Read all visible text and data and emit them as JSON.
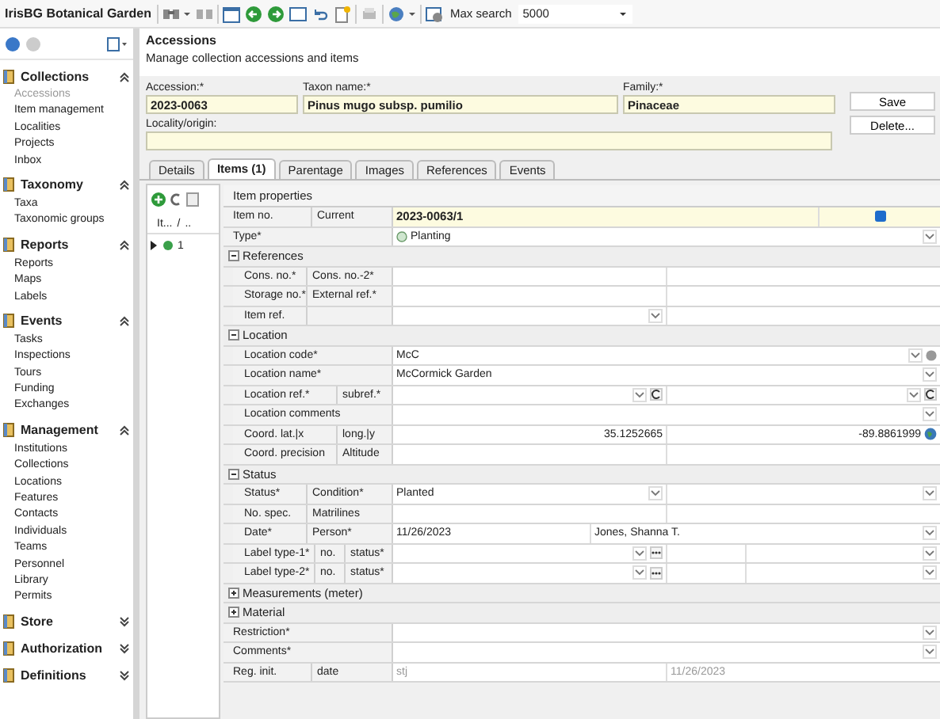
{
  "app": {
    "title": "IrisBG Botanical Garden",
    "max_search_label": "Max search",
    "max_search": "5000"
  },
  "sidebar": {
    "groups": [
      {
        "title": "Collections",
        "expanded": true,
        "items": [
          {
            "label": "Accessions",
            "selected": true
          },
          {
            "label": "Item management",
            "selected": false
          },
          {
            "label": "Localities",
            "selected": false
          },
          {
            "label": "Projects",
            "selected": false
          },
          {
            "label": "Inbox",
            "selected": false
          }
        ]
      },
      {
        "title": "Taxonomy",
        "expanded": true,
        "items": [
          {
            "label": "Taxa",
            "selected": false
          },
          {
            "label": "Taxonomic groups",
            "selected": false
          }
        ]
      },
      {
        "title": "Reports",
        "expanded": true,
        "items": [
          {
            "label": "Reports",
            "selected": false
          },
          {
            "label": "Maps",
            "selected": false
          },
          {
            "label": "Labels",
            "selected": false
          }
        ]
      },
      {
        "title": "Events",
        "expanded": true,
        "items": [
          {
            "label": "Tasks",
            "selected": false
          },
          {
            "label": "Inspections",
            "selected": false
          },
          {
            "label": "Tours",
            "selected": false
          },
          {
            "label": "Funding",
            "selected": false
          },
          {
            "label": "Exchanges",
            "selected": false
          }
        ]
      },
      {
        "title": "Management",
        "expanded": true,
        "items": [
          {
            "label": "Institutions",
            "selected": false
          },
          {
            "label": "Collections",
            "selected": false
          },
          {
            "label": "Locations",
            "selected": false
          },
          {
            "label": "Features",
            "selected": false
          },
          {
            "label": "Contacts",
            "selected": false
          },
          {
            "label": "Individuals",
            "selected": false
          },
          {
            "label": "Teams",
            "selected": false
          },
          {
            "label": "Personnel",
            "selected": false
          },
          {
            "label": "Library",
            "selected": false
          },
          {
            "label": "Permits",
            "selected": false
          }
        ]
      },
      {
        "title": "Store",
        "expanded": false
      },
      {
        "title": "Authorization",
        "expanded": false
      },
      {
        "title": "Definitions",
        "expanded": false
      }
    ]
  },
  "header": {
    "title": "Accessions",
    "subtitle": "Manage collection accessions and items"
  },
  "fields": [
    {
      "label": "Accession:*",
      "value": "2023-0063"
    },
    {
      "label": "Taxon name:*",
      "value": "Pinus mugo subsp. pumilio"
    },
    {
      "label": "Family:*",
      "value": "Pinaceae"
    },
    {
      "label": "Locality/origin:"
    }
  ],
  "buttons": [
    "Save",
    "Delete..."
  ],
  "tabs": [
    {
      "label": "Details",
      "selected": false
    },
    {
      "label": "Items (1)",
      "selected": true
    },
    {
      "label": "Parentage",
      "selected": false
    },
    {
      "label": "Images",
      "selected": false
    },
    {
      "label": "References",
      "selected": false
    },
    {
      "label": "Events",
      "selected": false
    }
  ],
  "item_list": {
    "columns": [
      "It...",
      "/",
      ".."
    ],
    "rows": [
      {
        "text": "1",
        "current": true
      }
    ]
  },
  "properties": {
    "title": "Item properties",
    "rows": [
      {
        "kind": "pair",
        "highlight": true,
        "labels": [
          "Item no.",
          "Current"
        ],
        "cells": [
          {
            "kind": "key",
            "text": "2023-0063/1"
          },
          {
            "kind": "check",
            "checked": true
          }
        ]
      },
      {
        "kind": "single",
        "labels": [
          "Type*"
        ],
        "cells": [
          {
            "kind": "icon-dropdown",
            "text": "Planting"
          }
        ]
      },
      {
        "kind": "section",
        "title": "References",
        "expanded": true,
        "children": [
          {
            "kind": "pair",
            "labels": [
              "Cons. no.*",
              "Cons. no.-2*"
            ],
            "cells": [
              {
                "kind": "text"
              },
              {
                "kind": "text"
              }
            ]
          },
          {
            "kind": "pair",
            "labels": [
              "Storage no.*",
              "External ref.*"
            ],
            "cells": [
              {
                "kind": "text"
              },
              {
                "kind": "text"
              }
            ]
          },
          {
            "kind": "pair",
            "labels": [
              "Item ref."
            ],
            "cells": [
              {
                "kind": "dropdown"
              },
              {
                "kind": "text"
              }
            ]
          }
        ]
      },
      {
        "kind": "section",
        "title": "Location",
        "expanded": true,
        "children": [
          {
            "kind": "single",
            "labels": [
              "Location code*"
            ],
            "cells": [
              {
                "kind": "dropdown-dot",
                "text": "McC"
              }
            ]
          },
          {
            "kind": "single",
            "labels": [
              "Location name*"
            ],
            "cells": [
              {
                "kind": "dropdown",
                "text": "McCormick Garden"
              }
            ]
          },
          {
            "kind": "wide",
            "labels": [
              "Location ref.*",
              "subref.*"
            ],
            "cells": [
              {
                "kind": "dropdown-refresh"
              },
              {
                "kind": "dropdown-refresh"
              }
            ]
          },
          {
            "kind": "single",
            "labels": [
              "Location comments"
            ],
            "cells": [
              {
                "kind": "dropdown"
              }
            ]
          },
          {
            "kind": "wide",
            "labels": [
              "Coord. lat.|x",
              "long.|y"
            ],
            "cells": [
              {
                "kind": "number",
                "text": "35.1252665"
              },
              {
                "kind": "globe",
                "text": "-89.8861999"
              }
            ]
          },
          {
            "kind": "wide",
            "labels": [
              "Coord. precision",
              "Altitude"
            ],
            "cells": [
              {
                "kind": "text"
              },
              {
                "kind": "text"
              }
            ]
          }
        ]
      },
      {
        "kind": "section",
        "title": "Status",
        "expanded": true,
        "children": [
          {
            "kind": "pair",
            "labels": [
              "Status*",
              "Condition*"
            ],
            "cells": [
              {
                "kind": "dropdown",
                "text": "Planted"
              },
              {
                "kind": "dropdown"
              }
            ]
          },
          {
            "kind": "pair",
            "labels": [
              "No. spec.",
              "Matrilines"
            ],
            "cells": [
              {
                "kind": "text"
              },
              {
                "kind": "text"
              }
            ]
          },
          {
            "kind": "pair",
            "labels": [
              "Date*",
              "Person*"
            ],
            "cells": [
              {
                "kind": "date",
                "text": "11/26/2023"
              },
              {
                "kind": "dropdown",
                "text": "Jones, Shanna T."
              }
            ]
          },
          {
            "kind": "triple",
            "labels": [
              "Label type-1*",
              "no.",
              "status*"
            ],
            "cells": [
              {
                "kind": "dropdown-more"
              },
              {
                "kind": "text"
              },
              {
                "kind": "dropdown"
              }
            ]
          },
          {
            "kind": "triple",
            "labels": [
              "Label type-2*",
              "no.",
              "status*"
            ],
            "cells": [
              {
                "kind": "dropdown-more"
              },
              {
                "kind": "text"
              },
              {
                "kind": "dropdown"
              }
            ]
          }
        ]
      },
      {
        "kind": "section",
        "title": "Measurements (meter)",
        "expanded": false
      },
      {
        "kind": "section",
        "title": "Material",
        "expanded": false
      },
      {
        "kind": "single",
        "labels": [
          "Restriction*"
        ],
        "cells": [
          {
            "kind": "dropdown"
          }
        ]
      },
      {
        "kind": "single",
        "labels": [
          "Comments*"
        ],
        "cells": [
          {
            "kind": "dropdown"
          }
        ]
      },
      {
        "kind": "pair",
        "labels": [
          "Reg. init.",
          "date"
        ],
        "cells": [
          {
            "kind": "muted",
            "text": "stj"
          },
          {
            "kind": "muted",
            "text": "11/26/2023"
          }
        ]
      }
    ]
  }
}
